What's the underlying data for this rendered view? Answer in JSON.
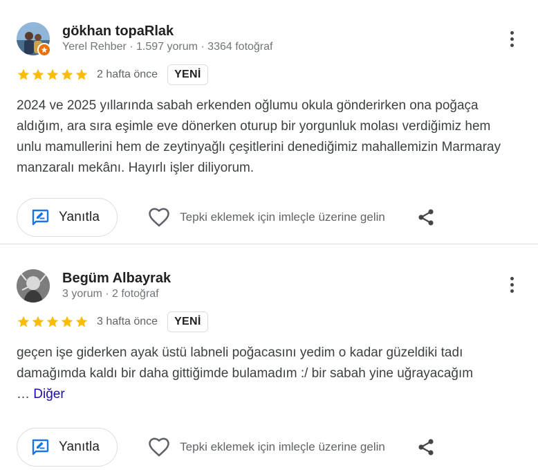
{
  "reviews": [
    {
      "author": "gökhan topaRlak",
      "meta": "Yerel Rehber · 1.597 yorum · 3364 fotoğraf",
      "rating": 5,
      "time": "2 hafta önce",
      "badge": "YENİ",
      "text": "2024 ve 2025 yıllarında sabah erkenden oğlumu okula gönderirken ona poğaça aldığım, ara sıra eşimle eve dönerken oturup bir yorgunluk molası verdiğimiz hem unlu mamullerini hem de zeytinyağlı çeşitlerini denediğimiz mahallemizin Marmaray manzaralı mekânı. Hayırlı işler diliyorum.",
      "reply_label": "Yanıtla",
      "react_label": "Tepki eklemek için imleçle üzerine gelin"
    },
    {
      "author": "Begüm Albayrak",
      "meta": "3 yorum · 2 fotoğraf",
      "rating": 5,
      "time": "3 hafta önce",
      "badge": "YENİ",
      "text": "geçen işe giderken ayak üstü labneli poğacasını yedim o kadar güzeldiki tadı damağımda kaldı bir daha gittiğimde bulamadım :/ bir sabah yine uğrayacağım",
      "ellipsis": "…",
      "more_label": "Diğer",
      "reply_label": "Yanıtla",
      "react_label": "Tepki eklemek için imleçle üzerine gelin"
    }
  ],
  "colors": {
    "star": "#fbbc04",
    "reply_icon": "#1a73e8",
    "link": "#1a0dab",
    "local_guide_badge": "#e8710a"
  },
  "icons": {
    "reply": "reply-edit-icon",
    "react": "heart-outline-icon",
    "share": "share-icon",
    "more": "more-vertical-icon",
    "star": "star-icon"
  }
}
